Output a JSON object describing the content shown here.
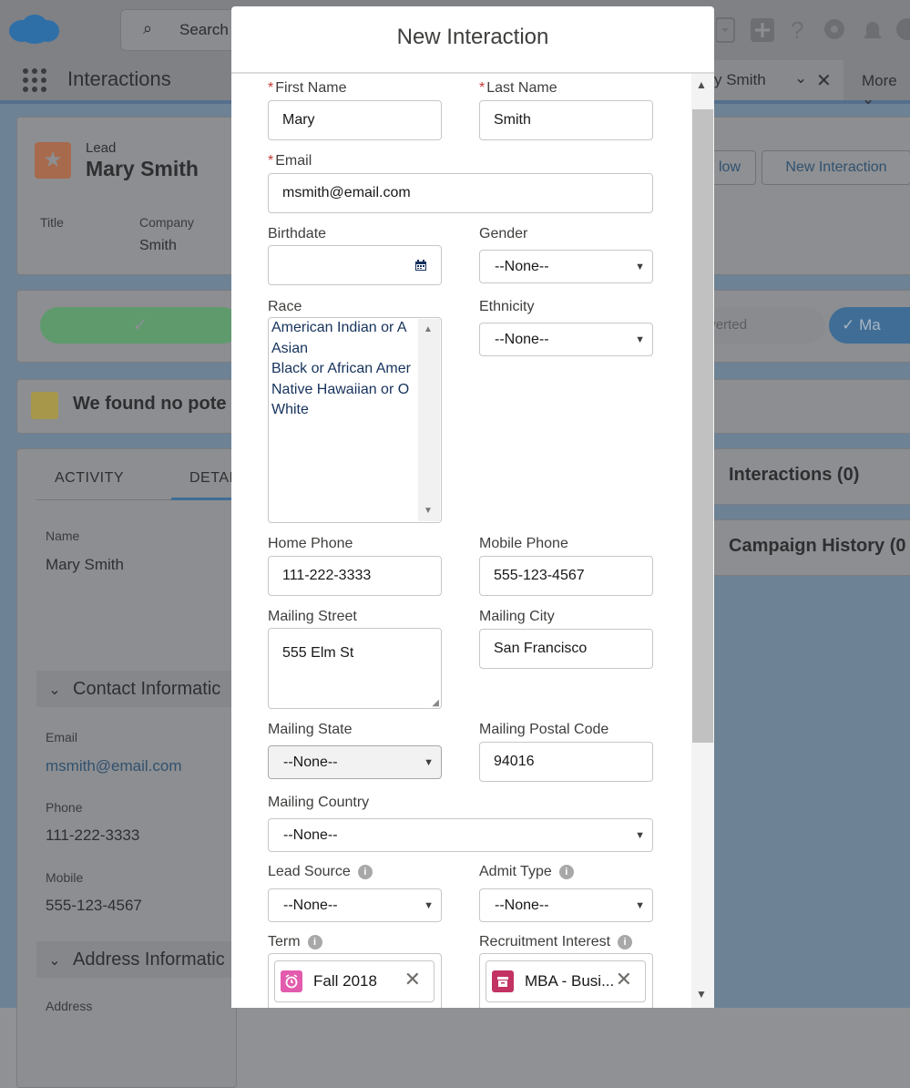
{
  "app": {
    "search_placeholder": "Search",
    "app_name": "Interactions",
    "tab_label": "y Smith",
    "more_label": "More"
  },
  "lead": {
    "type_label": "Lead",
    "name": "Mary Smith",
    "title_label": "Title",
    "company_label": "Company",
    "company_value": "Smith",
    "buttons": [
      "low",
      "New Interaction"
    ]
  },
  "path": {
    "converted_label": "nverted",
    "mark_label": "Ma"
  },
  "duplicate_text": "We found no pote",
  "detail_tabs": [
    "ACTIVITY",
    "DETAI"
  ],
  "details": {
    "name_label": "Name",
    "name_value": "Mary Smith",
    "section_contact": "Contact Informatic",
    "email_label": "Email",
    "email_value": "msmith@email.com",
    "phone_label": "Phone",
    "phone_value": "111-222-3333",
    "mobile_label": "Mobile",
    "mobile_value": "555-123-4567",
    "section_address": "Address Informatic",
    "address_label": "Address"
  },
  "related": {
    "interactions": "Interactions (0)",
    "campaign_history": "Campaign History (0"
  },
  "modal": {
    "title": "New Interaction",
    "fields": {
      "first_name_label": "First Name",
      "first_name_value": "Mary",
      "last_name_label": "Last Name",
      "last_name_value": "Smith",
      "email_label": "Email",
      "email_value": "msmith@email.com",
      "birthdate_label": "Birthdate",
      "gender_label": "Gender",
      "gender_value": "--None--",
      "race_label": "Race",
      "race_options": [
        "American Indian or A",
        "Asian",
        "Black or African Amer",
        "Native Hawaiian or O",
        "White"
      ],
      "ethnicity_label": "Ethnicity",
      "ethnicity_value": "--None--",
      "home_phone_label": "Home Phone",
      "home_phone_value": "111-222-3333",
      "mobile_phone_label": "Mobile Phone",
      "mobile_phone_value": "555-123-4567",
      "mailing_street_label": "Mailing Street",
      "mailing_street_value": "555 Elm St",
      "mailing_city_label": "Mailing City",
      "mailing_city_value": "San Francisco",
      "mailing_state_label": "Mailing State",
      "mailing_state_value": "--None--",
      "mailing_postal_label": "Mailing Postal Code",
      "mailing_postal_value": "94016",
      "mailing_country_label": "Mailing Country",
      "mailing_country_value": "--None--",
      "lead_source_label": "Lead Source",
      "lead_source_value": "--None--",
      "admit_type_label": "Admit Type",
      "admit_type_value": "--None--",
      "term_label": "Term",
      "term_value": "Fall 2018",
      "recruitment_label": "Recruitment Interest",
      "recruitment_value": "MBA - Busi..."
    }
  },
  "colors": {
    "required": "#c23934",
    "term_icon": "#e35bad",
    "recruitment_icon": "#c23263",
    "link": "#0070d2"
  }
}
